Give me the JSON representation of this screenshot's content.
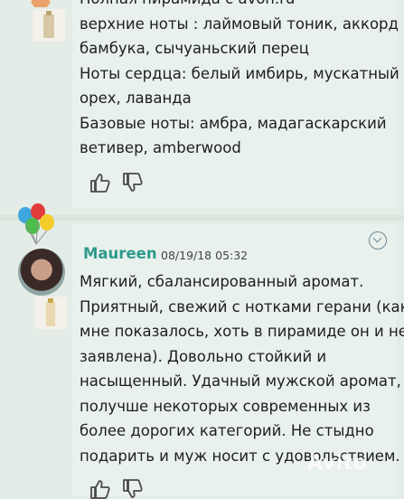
{
  "post1": {
    "lines": [
      "Полная пирамида с avon.ru",
      "верхние ноты : лаймовый тоник, аккорд",
      "бамбука, сычуаньский перец",
      "Ноты сердца: белый имбирь, мускатный",
      "орех, лаванда",
      "Базовые ноты: амбра, мадагаскарский",
      "ветивер, amberwood"
    ],
    "like_icon": "thumbs-up-outline",
    "dislike_icon": "thumbs-down-outline"
  },
  "post2": {
    "badge_icon": "balloons",
    "username": "Maureen",
    "date": "08/19/18 05:32",
    "lines": [
      "Мягкий, сбалансированный аромат.",
      "Приятный, свежий с нотками герани (как",
      "мне показалось, хоть в пирамиде он и не",
      "заявлена). Довольно стойкий и",
      "насыщенный. Удачный мужской аромат,",
      "получше некоторых современных из",
      "более дорогих категорий. Не стыдно",
      "подарить и муж носит с удовольствием."
    ],
    "like_icon": "thumbs-up-outline",
    "dislike_icon": "thumbs-down-outline",
    "expand_icon": "chevron-down-circle"
  },
  "watermark": "Avito",
  "colors": {
    "username": "#2e9a8c",
    "background": "#e3ece6"
  }
}
